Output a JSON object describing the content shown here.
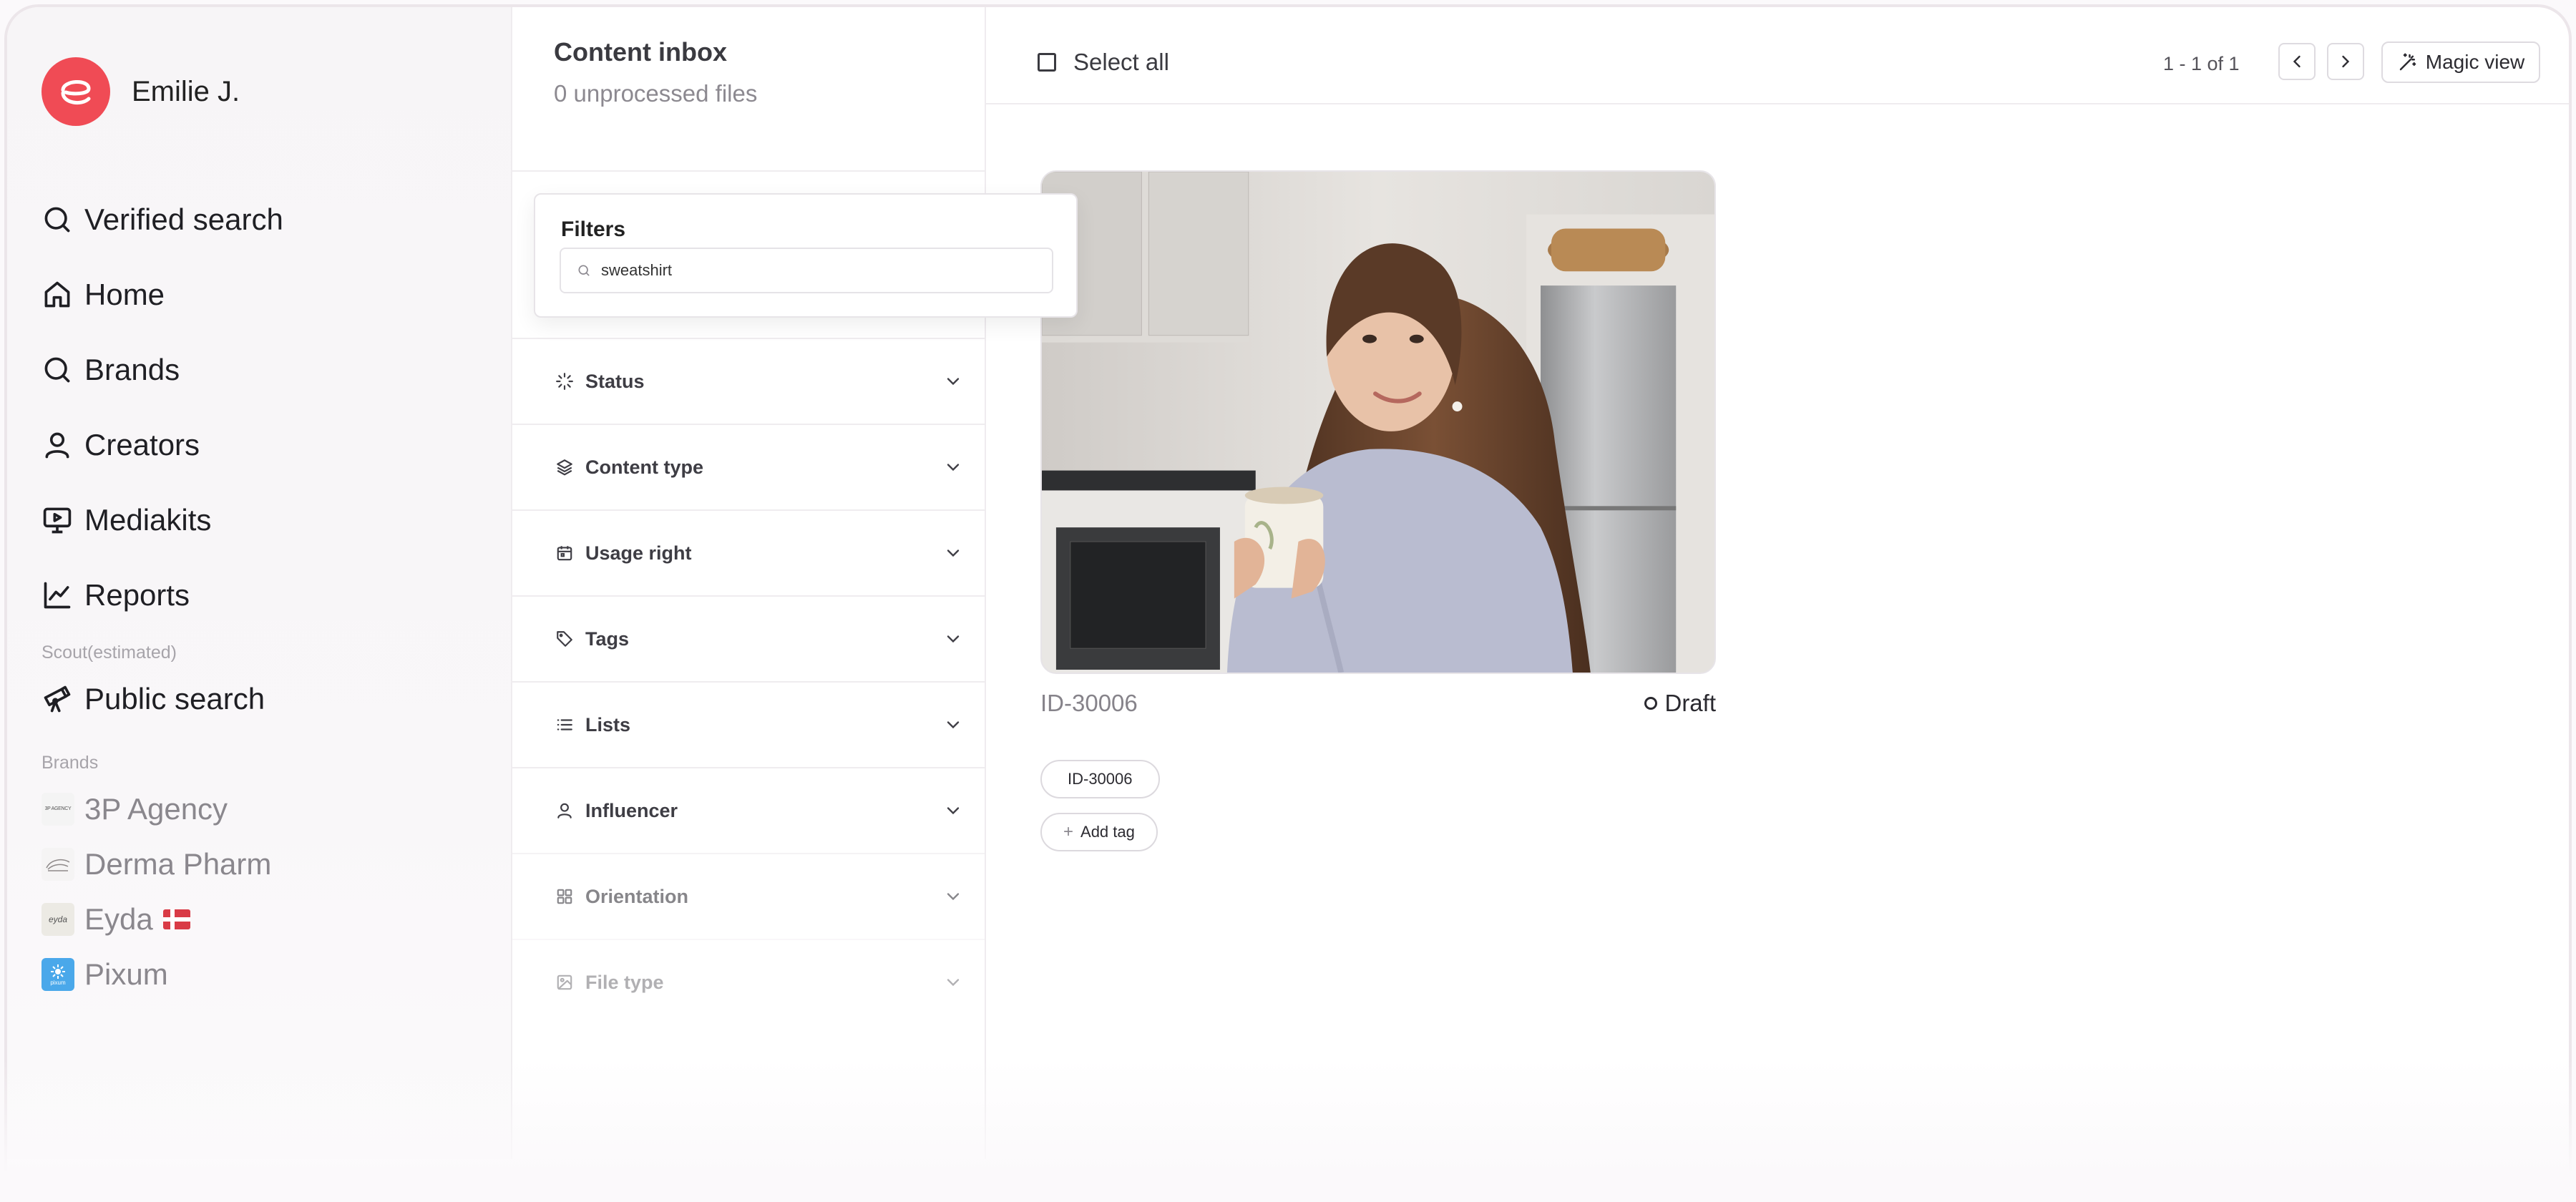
{
  "user": {
    "name": "Emilie J."
  },
  "nav": {
    "items": [
      {
        "label": "Verified search",
        "icon": "search-icon"
      },
      {
        "label": "Home",
        "icon": "home-icon"
      },
      {
        "label": "Brands",
        "icon": "search-icon"
      },
      {
        "label": "Creators",
        "icon": "user-icon"
      },
      {
        "label": "Mediakits",
        "icon": "presentation-icon"
      },
      {
        "label": "Reports",
        "icon": "chart-line-icon"
      }
    ],
    "scout_label": "Scout(estimated)",
    "public_search": {
      "label": "Public search",
      "icon": "telescope-icon"
    },
    "brands_label": "Brands",
    "brands": [
      {
        "label": "3P Agency",
        "logo_text": "3P AGENCY"
      },
      {
        "label": "Derma Pharm",
        "logo_text": ""
      },
      {
        "label": "Eyda",
        "logo_text": "eyda"
      },
      {
        "label": "Pixum",
        "logo_text": "pixum"
      }
    ]
  },
  "inbox": {
    "title": "Content inbox",
    "subtitle": "0 unprocessed files"
  },
  "filters": {
    "title": "Filters",
    "search_value": "sweatshirt",
    "sections": [
      {
        "label": "Status",
        "icon": "loader-icon"
      },
      {
        "label": "Content type",
        "icon": "layers-icon"
      },
      {
        "label": "Usage right",
        "icon": "calendar-icon"
      },
      {
        "label": "Tags",
        "icon": "tag-icon"
      },
      {
        "label": "Lists",
        "icon": "list-icon"
      },
      {
        "label": "Influencer",
        "icon": "user-icon"
      },
      {
        "label": "Orientation",
        "icon": "grid-icon"
      },
      {
        "label": "File type",
        "icon": "image-icon"
      }
    ]
  },
  "toolbar": {
    "select_all": "Select all",
    "pagination": "1 - 1 of 1",
    "magic_view": "Magic view"
  },
  "content": {
    "id": "ID-30006",
    "status": "Draft",
    "tag": "ID-30006",
    "add_tag": "Add tag"
  },
  "colors": {
    "brand": "#f04b55",
    "accent_text": "#1f1f24",
    "muted": "#8c8990"
  }
}
